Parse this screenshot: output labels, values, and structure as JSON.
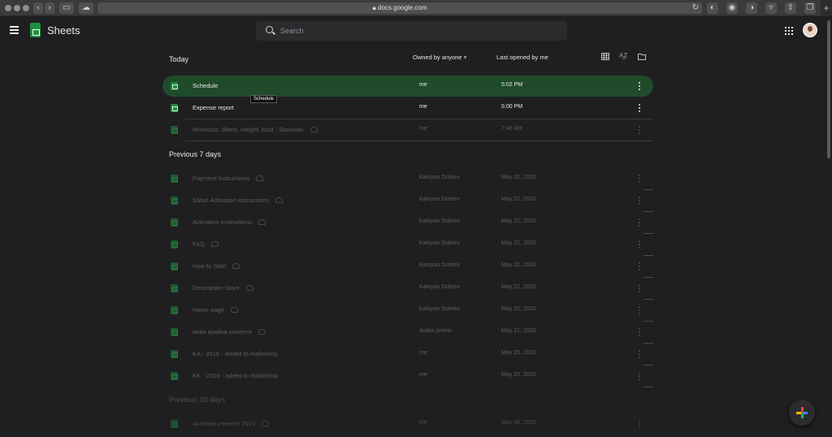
{
  "browser": {
    "url": "docs.google.com",
    "new_tab": "+"
  },
  "app": {
    "name": "Sheets",
    "search_placeholder": "Search"
  },
  "list": {
    "today_label": "Today",
    "owned_filter": "Owned by anyone",
    "sort_label": "Last opened by me",
    "prev7_label": "Previous 7 days",
    "prev30_label": "Previous 30 days",
    "tooltip": "Schedule"
  },
  "today_rows": [
    {
      "name": "Schedule",
      "owner": "me",
      "date": "5:02 PM",
      "shared": false,
      "selected": true
    },
    {
      "name": "Expense report",
      "owner": "me",
      "date": "5:00 PM",
      "shared": false
    },
    {
      "name": "Workouts, Sleep, weight, food - Stanislav",
      "owner": "me",
      "date": "7:46 AM",
      "shared": true
    }
  ],
  "prev7_rows": [
    {
      "name": "Payment Instructions",
      "owner": "Kaloyan Dobrev",
      "date": "May 22, 2020",
      "shared": true
    },
    {
      "name": "Safari Activation Instructions",
      "owner": "Kaloyan Dobrev",
      "date": "May 22, 2020",
      "shared": true
    },
    {
      "name": "Activation Instructions",
      "owner": "Kaloyan Dobrev",
      "date": "May 22, 2020",
      "shared": true
    },
    {
      "name": "FAQ",
      "owner": "Kaloyan Dobrev",
      "date": "May 22, 2020",
      "shared": true
    },
    {
      "name": "How to Start",
      "owner": "Kaloyan Dobrev",
      "date": "May 22, 2020",
      "shared": true
    },
    {
      "name": "Description Store",
      "owner": "Kaloyan Dobrev",
      "date": "May 22, 2020",
      "shared": true
    },
    {
      "name": "Home page",
      "owner": "Kaloyan Dobrev",
      "date": "May 22, 2020",
      "shared": true
    },
    {
      "name": "нови крайни клиенти",
      "owner": "avalia promo",
      "date": "May 21, 2020",
      "shared": true
    },
    {
      "name": "KA - 2019 - added to mailchimp",
      "owner": "me",
      "date": "May 20, 2020",
      "shared": false
    },
    {
      "name": "KK - 2019 - added to mailchimp",
      "owner": "me",
      "date": "May 20, 2020",
      "shared": false
    }
  ],
  "prev30_rows": [
    {
      "name": "Активни клиенти 2019",
      "owner": "me",
      "date": "May 18, 2020",
      "shared": true
    }
  ],
  "colors": {
    "selected_row": "#1f4b2b",
    "sheets_green": "#1e8e3e",
    "background": "#1f1f21"
  }
}
